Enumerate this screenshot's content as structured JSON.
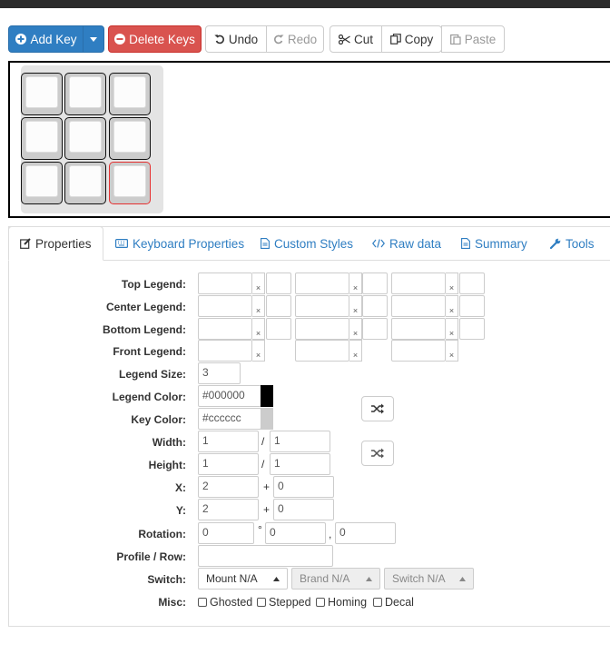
{
  "toolbar": {
    "add_key": "Add Key",
    "delete_keys": "Delete Keys",
    "undo": "Undo",
    "redo": "Redo",
    "cut": "Cut",
    "copy": "Copy",
    "paste": "Paste"
  },
  "tabs": {
    "properties": "Properties",
    "keyboard_properties": "Keyboard Properties",
    "custom_styles": "Custom Styles",
    "raw_data": "Raw data",
    "summary": "Summary",
    "tools": "Tools"
  },
  "form": {
    "top_legend": "Top Legend:",
    "center_legend": "Center Legend:",
    "bottom_legend": "Bottom Legend:",
    "front_legend": "Front Legend:",
    "legend_size": "Legend Size:",
    "legend_size_value": "3",
    "legend_color": "Legend Color:",
    "legend_color_value": "#000000",
    "key_color": "Key Color:",
    "key_color_value": "#cccccc",
    "width": "Width:",
    "width_value": "1",
    "width_value2": "1",
    "height": "Height:",
    "height_value": "1",
    "height_value2": "1",
    "x": "X:",
    "x_value": "2",
    "x_offset": "0",
    "y": "Y:",
    "y_value": "2",
    "y_offset": "0",
    "rotation": "Rotation:",
    "rotation_angle": "0",
    "rotation_x": "0",
    "rotation_y": "0",
    "profile_row": "Profile / Row:",
    "switch": "Switch:",
    "mount": "Mount N/A",
    "brand": "Brand N/A",
    "switch_type": "Switch N/A",
    "misc": "Misc:",
    "ghosted": "Ghosted",
    "stepped": "Stepped",
    "homing": "Homing",
    "decal": "Decal",
    "clear_mark": "×",
    "slash": "/",
    "plus": "+",
    "degree": "°",
    "comma": ","
  },
  "colors": {
    "primary": "#2f7ec2",
    "danger": "#d9534f",
    "selected_key_border": "#e53030",
    "legend_swatch": "#000000",
    "key_swatch": "#cccccc"
  }
}
